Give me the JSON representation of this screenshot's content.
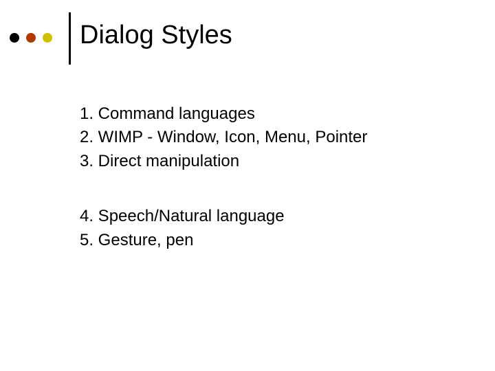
{
  "colors": {
    "dot1": "#000000",
    "dot2": "#b23a00",
    "dot3": "#cfc000"
  },
  "title": "Dialog Styles",
  "group1": [
    "1. Command languages",
    "2. WIMP - Window, Icon, Menu, Pointer",
    "3. Direct manipulation"
  ],
  "group2": [
    "4. Speech/Natural language",
    "5. Gesture, pen"
  ]
}
